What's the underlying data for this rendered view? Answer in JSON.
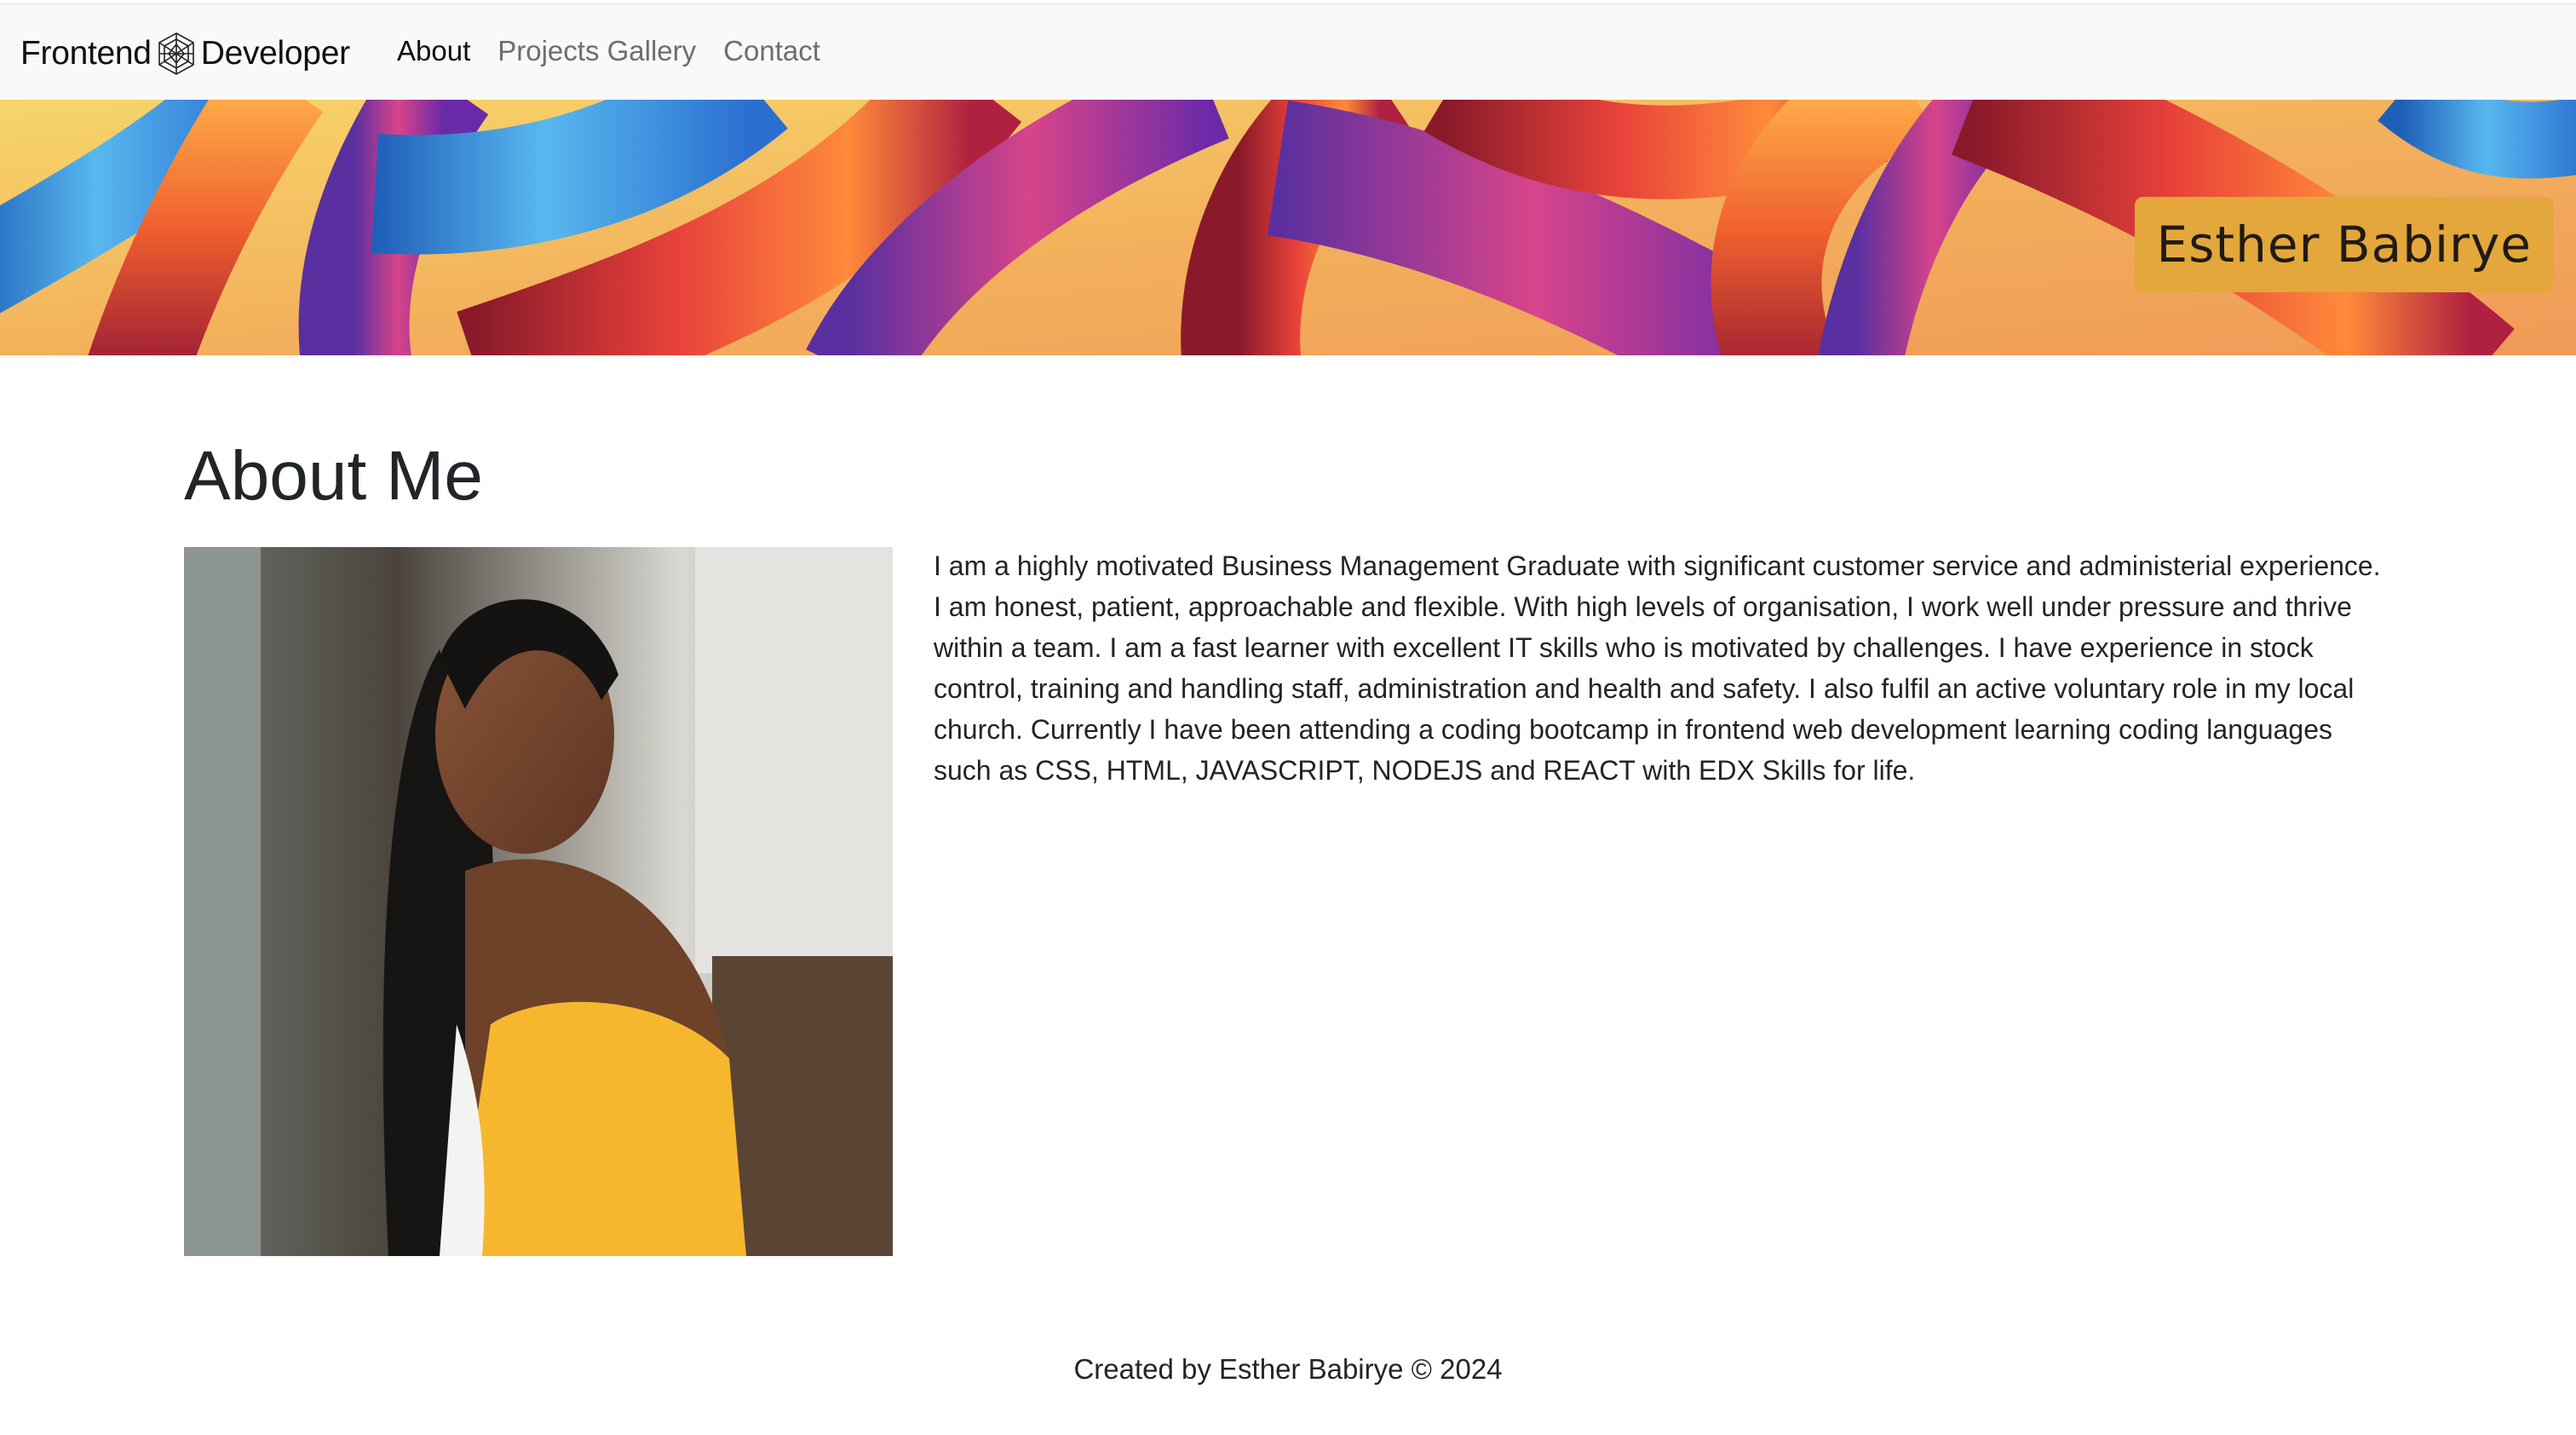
{
  "nav": {
    "brand_left": "Frontend",
    "brand_right": "Developer",
    "logo_icon": "wireframe-globe-icon",
    "links": [
      {
        "label": "About",
        "active": true
      },
      {
        "label": "Projects Gallery",
        "active": false
      },
      {
        "label": "Contact",
        "active": false
      }
    ]
  },
  "banner": {
    "name": "Esther Babirye",
    "badge_color": "#e3a73b"
  },
  "about": {
    "heading": "About Me",
    "bio": "I am a highly motivated Business Management Graduate with significant customer service and administerial experience. I am honest, patient, approachable and flexible. With high levels of organisation, I work well under pressure and thrive within a team. I am a fast learner with excellent IT skills who is motivated by challenges. I have experience in stock control, training and handling staff, administration and health and safety. I also fulfil an active voluntary role in my local church. Currently I have been attending a coding bootcamp in frontend web development learning coding languages such as CSS, HTML, JAVASCRIPT, NODEJS and REACT with EDX Skills for life."
  },
  "footer": {
    "text": "Created by Esther Babirye © 2024"
  }
}
